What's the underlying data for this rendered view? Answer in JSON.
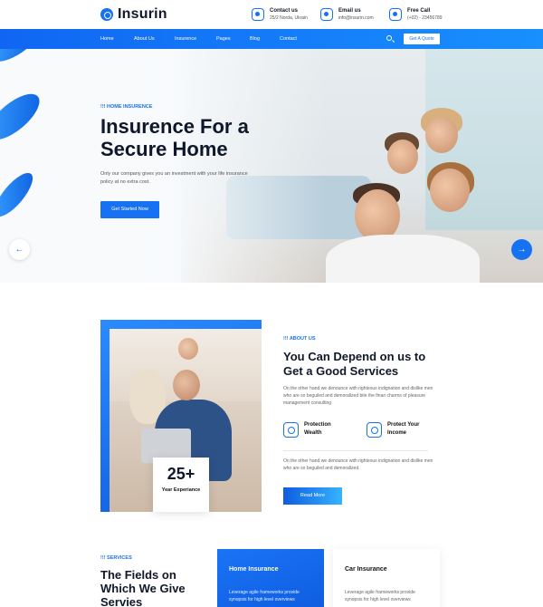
{
  "brand": {
    "name": "Insurin"
  },
  "contacts": [
    {
      "label": "Contact us",
      "value": "25/2 Norda, Ukrain"
    },
    {
      "label": "Email us",
      "value": "info@insurin.com"
    },
    {
      "label": "Free Call",
      "value": "(+02) - 23456789"
    }
  ],
  "nav": {
    "items": [
      "Home",
      "About Us",
      "Insurence",
      "Pages",
      "Blog",
      "Contact"
    ],
    "quote_button": "Get A Quote"
  },
  "hero": {
    "tag": "!!! HOME INSURENCE",
    "title": "Insurence For a Secure Home",
    "description": "Only our company gives you an investment with your life insurance policy at no extra cost.",
    "cta": "Get Started Now",
    "prev": "←",
    "next": "→"
  },
  "about": {
    "experience_number": "25+",
    "experience_label": "Year Experiance",
    "tag": "!!! ABOUT US",
    "title": "You Can Depend on us to Get a Good Services",
    "paragraph1": "On the other hand we denounce with righteous indignation and dislike men who are so beguiled and demoralized bite the finan charms of pleasure management consulting",
    "features": [
      "Protection Wealth",
      "Protect Your Income"
    ],
    "paragraph2": "On the other hand we denounce with righteous indignation and dislike men who are so beguiled and demoralized.",
    "cta": "Read More"
  },
  "services": {
    "tag": "!!! SERVICES",
    "title": "The Fields on Which We Give Servies",
    "cards": [
      {
        "title": "Home Insurance",
        "desc": "Leverage agile frameworks provide synopsis for high level overviews"
      },
      {
        "title": "Car Insurance",
        "desc": "Leverage agile frameworks provide synopsis for high level overviews"
      }
    ]
  },
  "colors": {
    "primary": "#1672f3",
    "dark_text": "#0f172a"
  }
}
